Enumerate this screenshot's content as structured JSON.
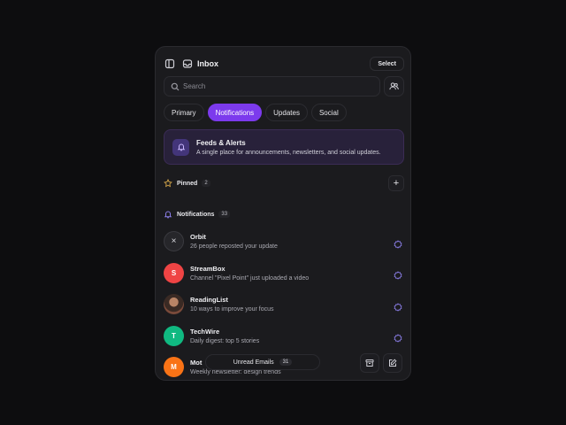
{
  "header": {
    "title": "Inbox",
    "select_label": "Select"
  },
  "search": {
    "placeholder": "Search"
  },
  "tabs": [
    {
      "label": "Primary",
      "active": false
    },
    {
      "label": "Notifications",
      "active": true
    },
    {
      "label": "Updates",
      "active": false
    },
    {
      "label": "Social",
      "active": false
    }
  ],
  "feed_card": {
    "title": "Feeds & Alerts",
    "description": "A single place for announcements, newsletters, and social updates.",
    "icon": "bell-icon"
  },
  "pinned": {
    "label": "Pinned",
    "count": "2",
    "icon": "star-icon"
  },
  "notifications_section": {
    "label": "Notifications",
    "count": "33",
    "icon": "bell-icon"
  },
  "notifications": [
    {
      "name": "Orbit",
      "message": "26 people reposted your update",
      "avatar": "×",
      "avatar_type": "close",
      "color": "#26262a"
    },
    {
      "name": "StreamBox",
      "message": "Channel \"Pixel Point\" just uploaded a video",
      "avatar": "S",
      "avatar_type": "letter",
      "color": "#ef4444"
    },
    {
      "name": "ReadingList",
      "message": "10 ways to improve your focus",
      "avatar": "",
      "avatar_type": "photo",
      "color": "#5a3a30"
    },
    {
      "name": "TechWire",
      "message": "Daily digest: top 5 stories",
      "avatar": "T",
      "avatar_type": "letter",
      "color": "#10b981"
    },
    {
      "name": "Mot",
      "message": "Weekly newsletter: design trends",
      "avatar": "M",
      "avatar_type": "letter",
      "color": "#f97316"
    }
  ],
  "bottom": {
    "unread_label": "Unread Emails",
    "unread_count": "31"
  },
  "colors": {
    "accent": "#7c3aed",
    "badge": "#8b7ee8",
    "star": "#d4a64a"
  }
}
